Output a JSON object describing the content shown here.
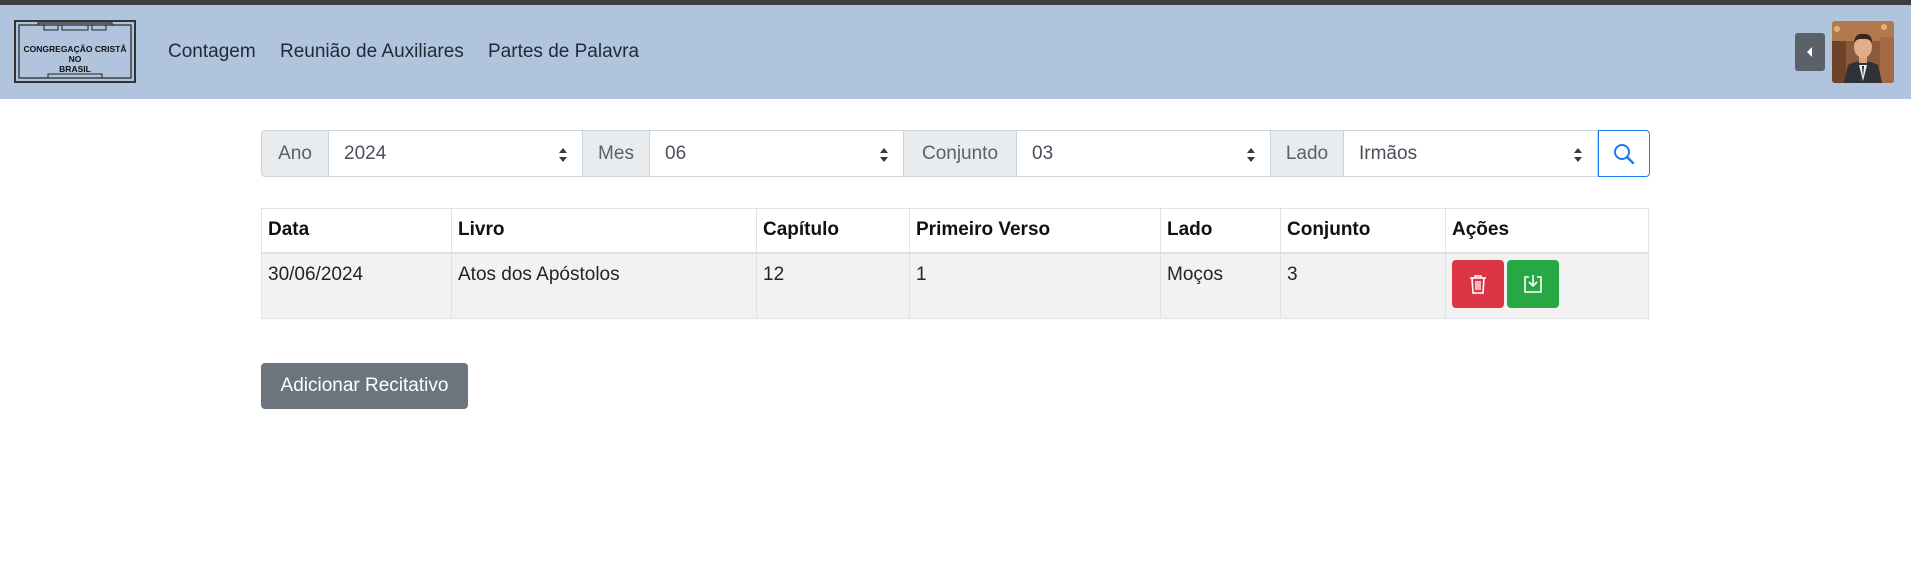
{
  "header": {
    "logo_text": [
      "CONGREGAÇÃO CRISTÃ",
      "NO",
      "BRASIL"
    ],
    "nav_links": [
      "Contagem",
      "Reunião de Auxiliares",
      "Partes de Palavra"
    ],
    "bg_color": "#b0c4de"
  },
  "filters": {
    "ano": {
      "label": "Ano",
      "value": "2024"
    },
    "mes": {
      "label": "Mes",
      "value": "06"
    },
    "conjunto": {
      "label": "Conjunto",
      "value": "03"
    },
    "lado": {
      "label": "Lado",
      "value": "Irmãos"
    },
    "search_icon": "search-icon"
  },
  "table": {
    "headers": [
      "Data",
      "Livro",
      "Capítulo",
      "Primeiro Verso",
      "Lado",
      "Conjunto",
      "Ações"
    ],
    "rows": [
      {
        "data": "30/06/2024",
        "livro": "Atos dos Apóstolos",
        "capitulo": "12",
        "primeiro_verso": "1",
        "lado": "Moços",
        "conjunto": "3"
      }
    ],
    "action_icons": [
      "trash-icon",
      "download-icon"
    ],
    "delete_color": "#dc3545",
    "download_color": "#28a745"
  },
  "add_button": {
    "label": "Adicionar Recitativo",
    "color": "#6c757d"
  }
}
